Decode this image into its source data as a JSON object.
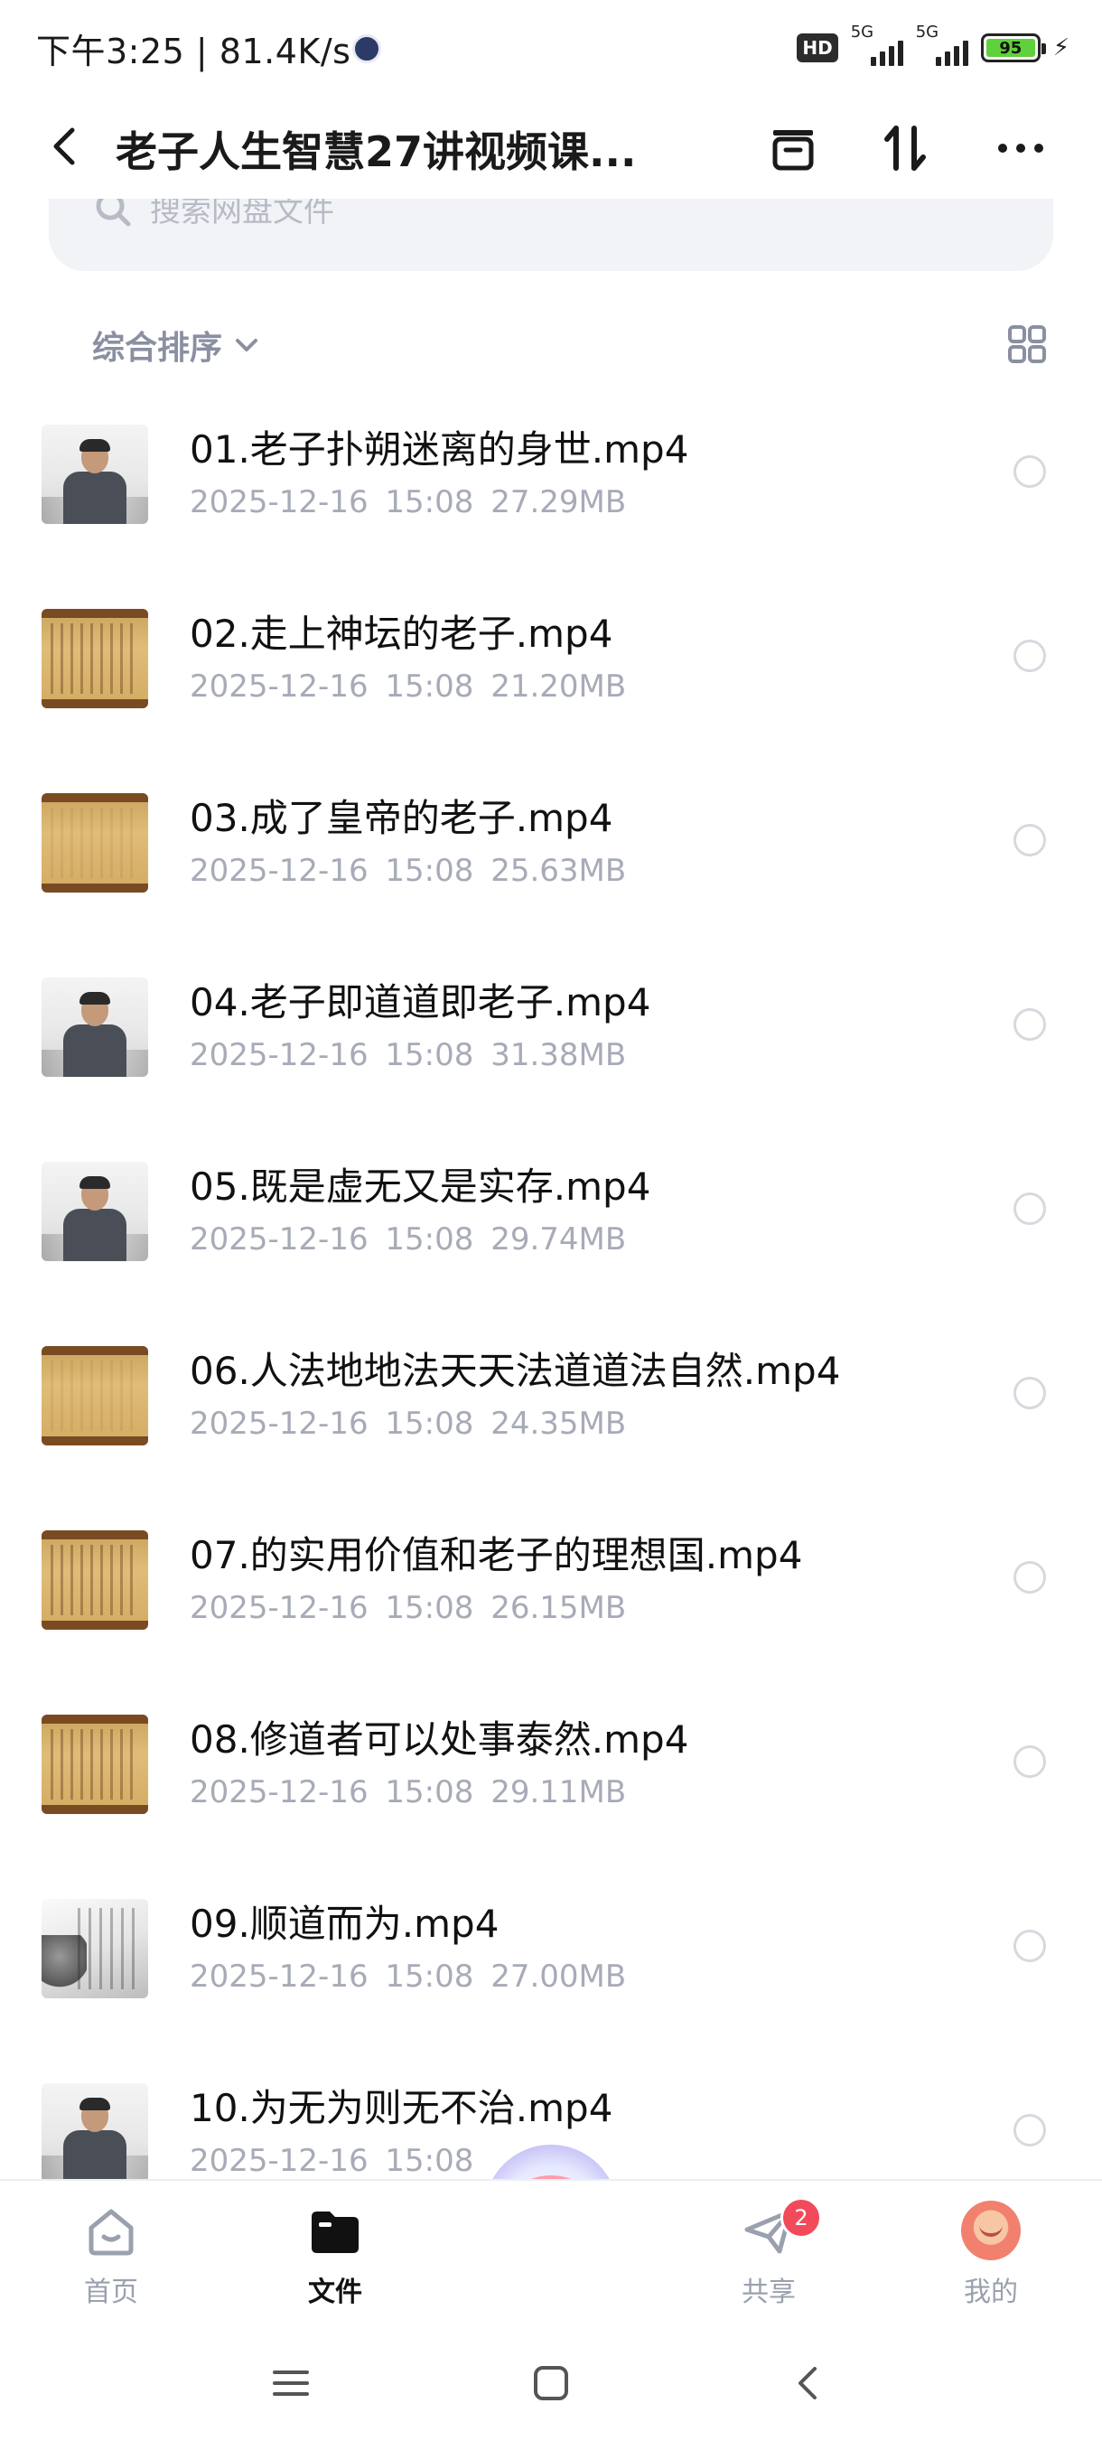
{
  "status_bar": {
    "time": "下午3:25 | 81.4K/s",
    "hd_label": "HD",
    "sim1_label": "5G",
    "sim2_label": "5G",
    "battery_level": "95",
    "battery_color": "#5fd13c"
  },
  "header": {
    "title": "老子人生智慧27讲视频课...",
    "back_icon": "chevron-left-icon",
    "actions": [
      "archive-icon",
      "sort-arrows-icon",
      "more-icon"
    ]
  },
  "search": {
    "placeholder": "搜索网盘文件"
  },
  "sort": {
    "label": "综合排序"
  },
  "files": [
    {
      "name": "01.老子扑朔迷离的身世.mp4",
      "date": "2025-12-16",
      "time": "15:08",
      "size": "27.29MB",
      "thumb": "person"
    },
    {
      "name": "02.走上神坛的老子.mp4",
      "date": "2025-12-16",
      "time": "15:08",
      "size": "21.20MB",
      "thumb": "scroll"
    },
    {
      "name": "03.成了皇帝的老子.mp4",
      "date": "2025-12-16",
      "time": "15:08",
      "size": "25.63MB",
      "thumb": "scroll-plain"
    },
    {
      "name": "04.老子即道道即老子.mp4",
      "date": "2025-12-16",
      "time": "15:08",
      "size": "31.38MB",
      "thumb": "person"
    },
    {
      "name": "05.既是虚无又是实存.mp4",
      "date": "2025-12-16",
      "time": "15:08",
      "size": "29.74MB",
      "thumb": "person"
    },
    {
      "name": "06.人法地地法天天法道道法自然.mp4",
      "date": "2025-12-16",
      "time": "15:08",
      "size": "24.35MB",
      "thumb": "scroll-plain"
    },
    {
      "name": "07.的实用价值和老子的理想国.mp4",
      "date": "2025-12-16",
      "time": "15:08",
      "size": "26.15MB",
      "thumb": "scroll"
    },
    {
      "name": "08.修道者可以处事泰然.mp4",
      "date": "2025-12-16",
      "time": "15:08",
      "size": "29.11MB",
      "thumb": "scroll"
    },
    {
      "name": "09.顺道而为.mp4",
      "date": "2025-12-16",
      "time": "15:08",
      "size": "27.00MB",
      "thumb": "ink"
    },
    {
      "name": "10.为无为则无不治.mp4",
      "date": "2025-12-16",
      "time": "15:08",
      "size": "",
      "thumb": "person"
    }
  ],
  "bottom_nav": [
    {
      "label": "首页",
      "icon": "home-icon",
      "active": false
    },
    {
      "label": "文件",
      "icon": "folder-icon",
      "active": true
    },
    {
      "label": "共享",
      "icon": "send-icon",
      "active": false,
      "badge": "2"
    },
    {
      "label": "我的",
      "icon": "avatar-icon",
      "active": false
    }
  ],
  "colors": {
    "accent_badge": "#f24a5a",
    "muted_text": "#a7abb7",
    "search_bg": "#f2f3f7"
  }
}
